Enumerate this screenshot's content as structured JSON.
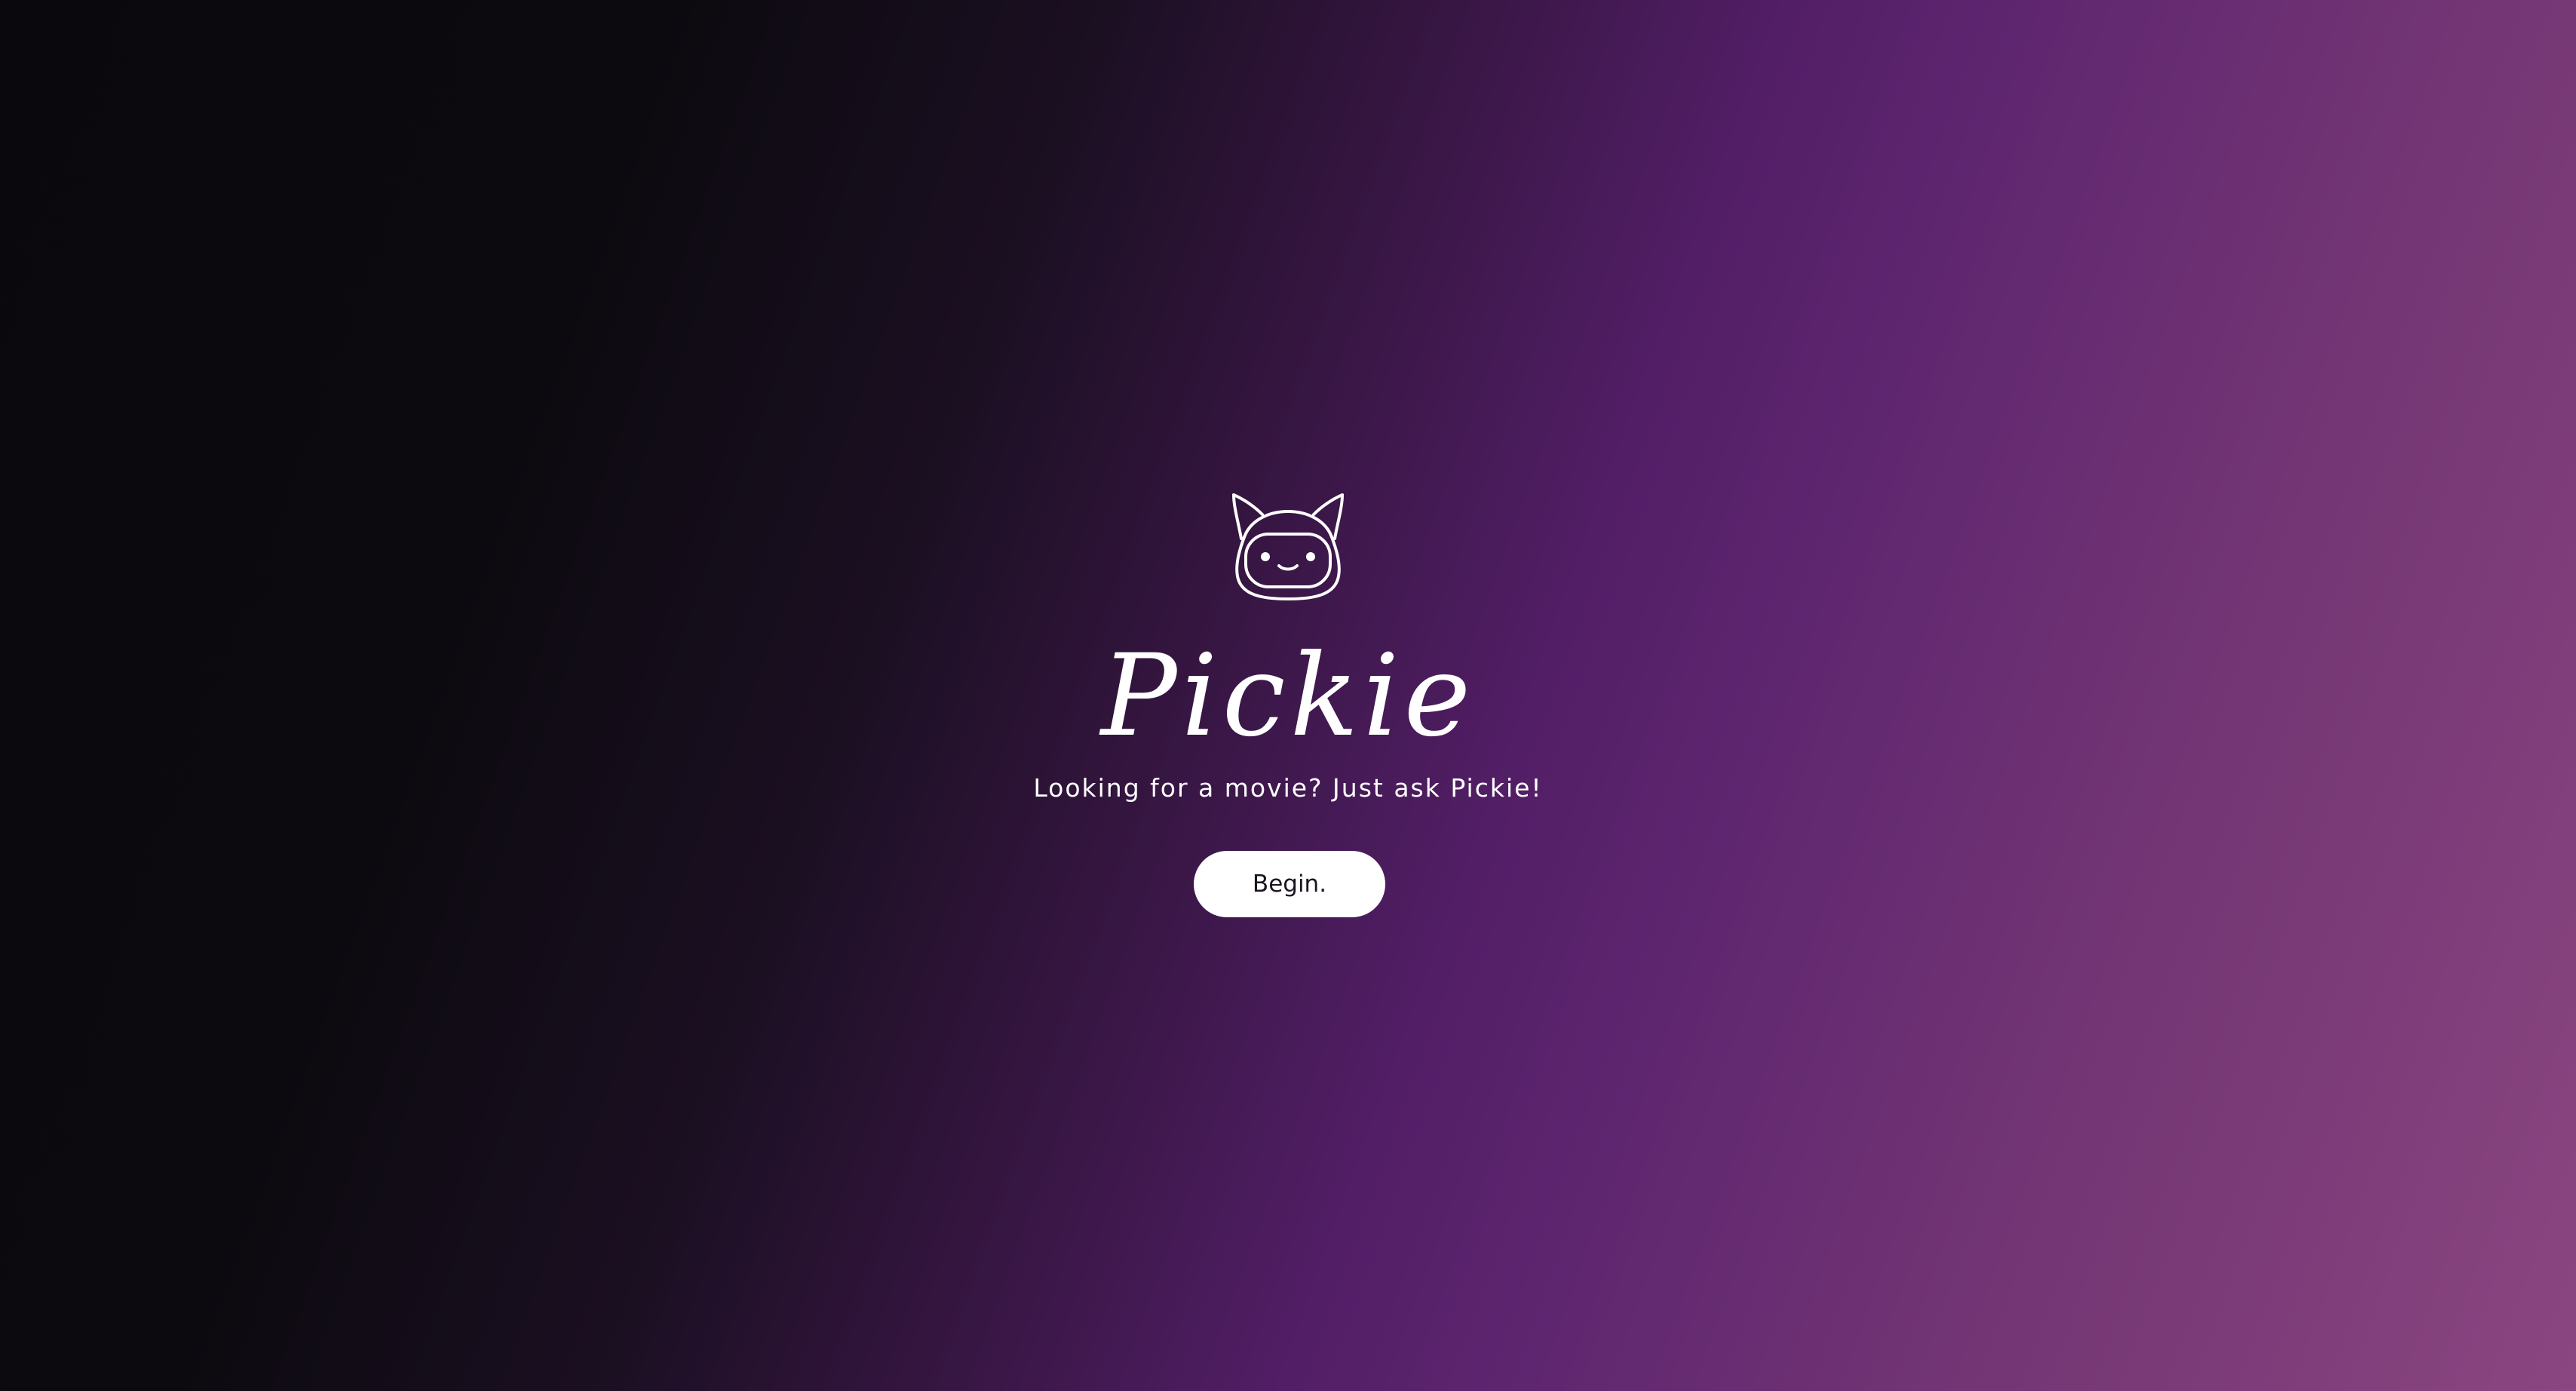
{
  "app": {
    "logo_icon": "robot-cat-face-icon",
    "title": "Pickie",
    "tagline": "Looking for a movie? Just ask Pickie!",
    "begin_label": "Begin."
  },
  "colors": {
    "text": "#ffffff",
    "button_bg": "#ffffff",
    "button_text": "#1c1420",
    "bg_dark": "#0b080d",
    "bg_purple": "#521e66",
    "bg_pink": "#8a4680"
  }
}
